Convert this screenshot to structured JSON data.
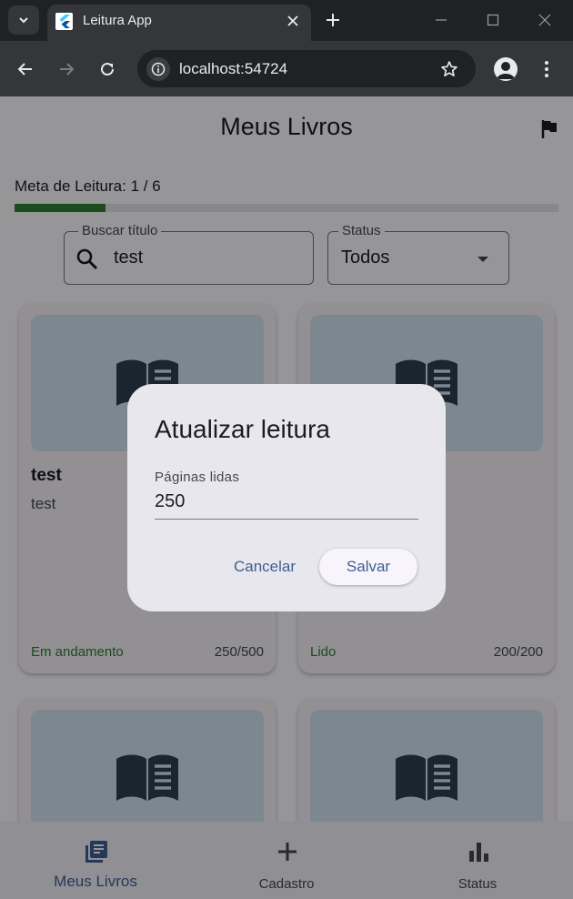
{
  "browser": {
    "tab_title": "Leitura App",
    "url": "localhost:54724"
  },
  "app": {
    "title": "Meus Livros",
    "goal_label": "Meta de Leitura: 1 / 6",
    "goal_progress": 0.1667,
    "search": {
      "label": "Buscar título",
      "value": "test"
    },
    "status_filter": {
      "label": "Status",
      "value": "Todos"
    },
    "books": [
      {
        "title": "test",
        "author": "test",
        "status": "Em andamento",
        "pages": "250/500"
      },
      {
        "title": "",
        "author": "",
        "status": "Lido",
        "pages": "200/200"
      },
      {
        "title": "",
        "author": "",
        "status": "",
        "pages": ""
      },
      {
        "title": "",
        "author": "",
        "status": "",
        "pages": ""
      }
    ],
    "colors": {
      "primary": "#3e5f90",
      "progress": "#2e7d32",
      "card_image": "#cfe2f0",
      "book_icon": "#2e3f4f"
    }
  },
  "bottom_nav": [
    {
      "label": "Meus Livros",
      "icon": "library-books-icon",
      "selected": true
    },
    {
      "label": "Cadastro",
      "icon": "add-icon",
      "selected": false
    },
    {
      "label": "Status",
      "icon": "bar-chart-icon",
      "selected": false
    }
  ],
  "dialog": {
    "title": "Atualizar leitura",
    "field_label": "Páginas lidas",
    "field_value": "250",
    "cancel_label": "Cancelar",
    "save_label": "Salvar"
  }
}
